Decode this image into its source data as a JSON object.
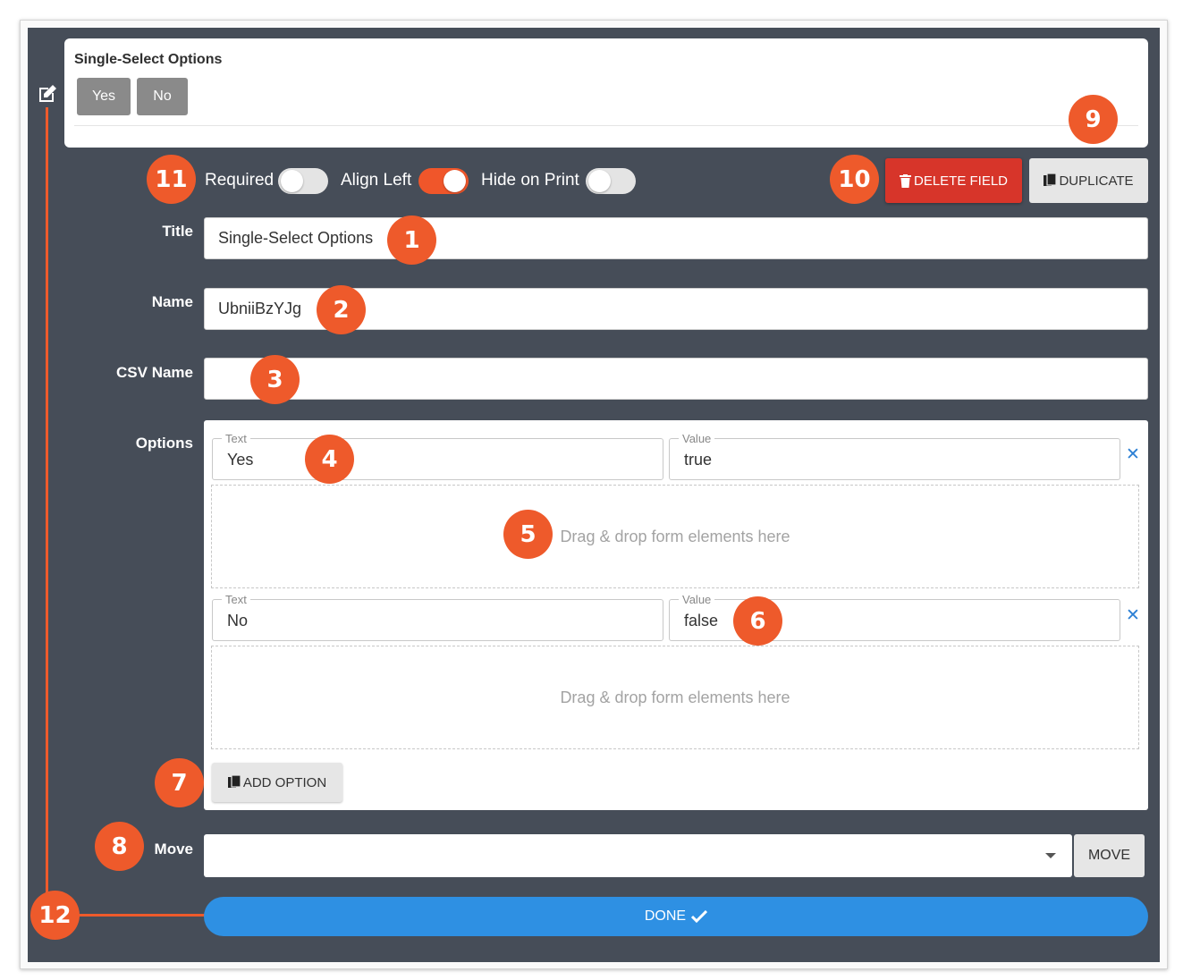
{
  "preview": {
    "title": "Single-Select Options",
    "options": [
      "Yes",
      "No"
    ]
  },
  "toggles": [
    {
      "label": "Required",
      "on": false
    },
    {
      "label": "Align Left",
      "on": true
    },
    {
      "label": "Hide on Print",
      "on": false
    }
  ],
  "actions": {
    "delete_label": "DELETE FIELD",
    "duplicate_label": "DUPLICATE"
  },
  "form": {
    "title_label": "Title",
    "title_value": "Single-Select Options",
    "name_label": "Name",
    "name_value": "UbniiBzYJg",
    "csv_label": "CSV Name",
    "csv_value": "",
    "options_label": "Options",
    "move_label": "Move",
    "move_value": "",
    "move_button": "MOVE",
    "done_label": "DONE"
  },
  "options": {
    "text_legend": "Text",
    "value_legend": "Value",
    "items": [
      {
        "text": "Yes",
        "value": "true"
      },
      {
        "text": "No",
        "value": "false"
      }
    ],
    "dropzone_text": "Drag & drop form elements here",
    "add_label": "ADD OPTION"
  },
  "badges": [
    "1",
    "2",
    "3",
    "4",
    "5",
    "6",
    "7",
    "8",
    "9",
    "10",
    "11",
    "12"
  ],
  "colors": {
    "panel": "#464d58",
    "accent": "#ee5a2b",
    "delete": "#d7352a",
    "done": "#2e90e3",
    "close_x": "#2b7fd4"
  },
  "icons": {
    "edit": "edit-icon",
    "trash": "trash-icon",
    "copy": "copy-icon",
    "check": "checkmark-icon",
    "close": "close-icon",
    "caret": "chevron-down-icon"
  }
}
